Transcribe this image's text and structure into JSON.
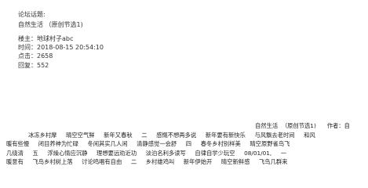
{
  "topic": {
    "label": "论坛话题:",
    "title": "自然生活  （原创节选1)"
  },
  "post_meta": {
    "author_line": "楼主：地球村子abc",
    "time_line": "时间：2018-08-15 20:54:10",
    "clicks_line": "点击：2658",
    "replies_line": "回复：552"
  },
  "body_lines": [
    "自然生活  （原创节选1)      作者：自",
    "冰冻乡村摩     晴空空气鲜     新年又春秋     二     感慨不想再多说     新年要有新快乐     与风飘去老时间     和风",
    "暖有些慢     闭目养神为忙碌     冬闲其实几人闲     清静感觉一会舒     四     春冬乡村别样美     晴空原野雀鸟飞",
    "几绕清     五     浮燥心情应沉静     理想要远劝近功     淡泊名利多读写     自律自学少玩空     08/01/01,     一",
    "暖意有     飞鸟乡村树上落     讨论鸣唱有自由     二     乡村雄鸡叫     新年伊始开     晴空新鲜感     飞鸟几群来"
  ]
}
